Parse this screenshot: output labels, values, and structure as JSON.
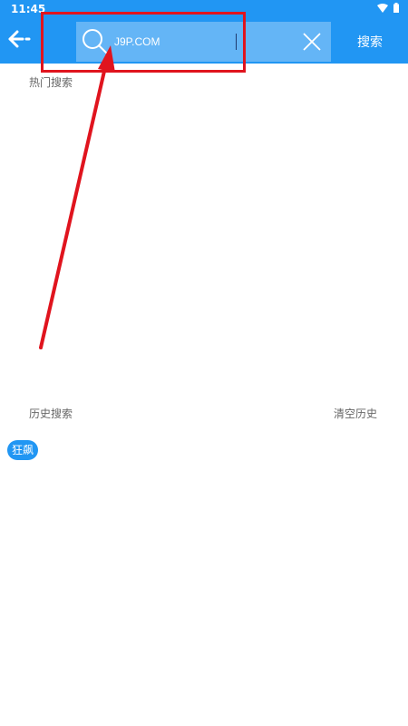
{
  "status_bar": {
    "time": "11:45",
    "icons": [
      "wifi-icon",
      "battery-icon"
    ]
  },
  "header": {
    "back_icon": "back-arrow-icon",
    "search": {
      "value": "J9P.COM",
      "icon": "search-icon",
      "clear_icon": "close-icon"
    },
    "search_button_label": "搜索"
  },
  "hot_search": {
    "label": "热门搜索"
  },
  "history": {
    "label": "历史搜索",
    "clear_label": "清空历史",
    "items": [
      "狂飙"
    ]
  },
  "colors": {
    "primary": "#2196f3",
    "search_box": "#64b5f6",
    "annotation": "#e0141e"
  }
}
